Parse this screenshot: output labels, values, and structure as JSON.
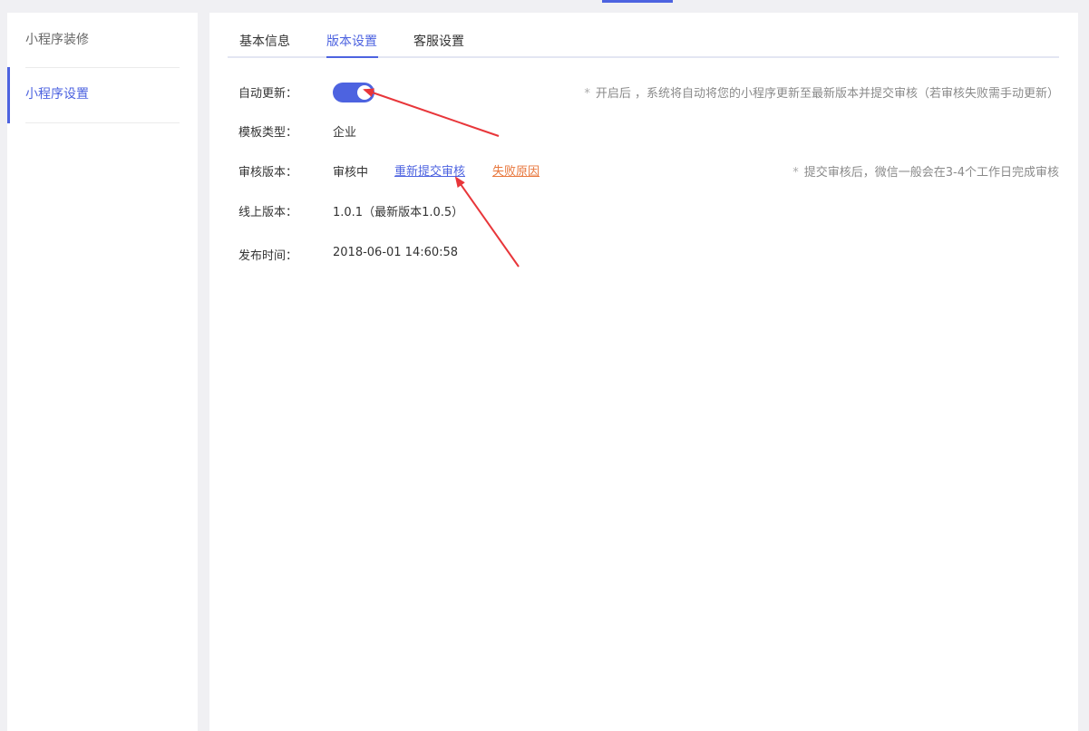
{
  "sidebar": {
    "items": [
      {
        "label": "小程序装修",
        "active": false
      },
      {
        "label": "小程序设置",
        "active": true
      }
    ]
  },
  "tabs": [
    {
      "label": "基本信息",
      "active": false
    },
    {
      "label": "版本设置",
      "active": true
    },
    {
      "label": "客服设置",
      "active": false
    }
  ],
  "settings": {
    "auto_update": {
      "label": "自动更新：",
      "enabled": true,
      "hint_star": "*",
      "hint": "开启后 ，系统将自动将您的小程序更新至最新版本并提交审核（若审核失败需手动更新）"
    },
    "template_type": {
      "label": "模板类型：",
      "value": "企业"
    },
    "review_version": {
      "label": "审核版本：",
      "status": "审核中",
      "resubmit_link": "重新提交审核",
      "fail_reason_link": "失败原因",
      "hint_star": "*",
      "hint": "提交审核后，微信一般会在3-4个工作日完成审核"
    },
    "online_version": {
      "label": "线上版本：",
      "value": "1.0.1（最新版本1.0.5）"
    },
    "publish_time": {
      "label": "发布时间：",
      "value": "2018-06-01 14:60:58"
    }
  },
  "colors": {
    "accent": "#4d63e0",
    "warning_link": "#e8773d",
    "annotation_arrow": "#e8363a"
  }
}
